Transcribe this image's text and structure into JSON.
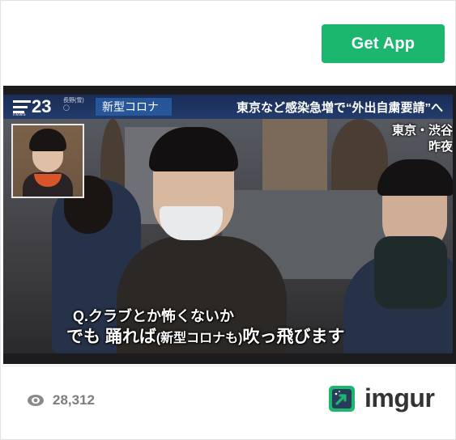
{
  "header": {
    "get_app_label": "Get App"
  },
  "media": {
    "broadcast": {
      "program_small": "news",
      "program_number": "23",
      "weather_lines": [
        "長野(雪)",
        "◯"
      ],
      "topic": "新型コロナ",
      "headline": "東京など感染急増で“外出自粛要請”へ",
      "location_lines": [
        "東京・渋谷",
        "昨夜"
      ]
    },
    "captions": {
      "question": "Q.クラブとか怖くないか",
      "answer_part1": "でも 踊れば",
      "answer_paren": "(新型コロナも)",
      "answer_part2": "吹っ飛びます"
    }
  },
  "footer": {
    "views_icon": "eye-icon",
    "views_count": "28,312",
    "brand_icon": "imgur-logo-icon",
    "brand_name": "imgur"
  },
  "colors": {
    "accent_green": "#1bb76e",
    "caption_text": "#ffffff",
    "views_gray": "#7d7d7d",
    "brand_text": "#333333"
  }
}
